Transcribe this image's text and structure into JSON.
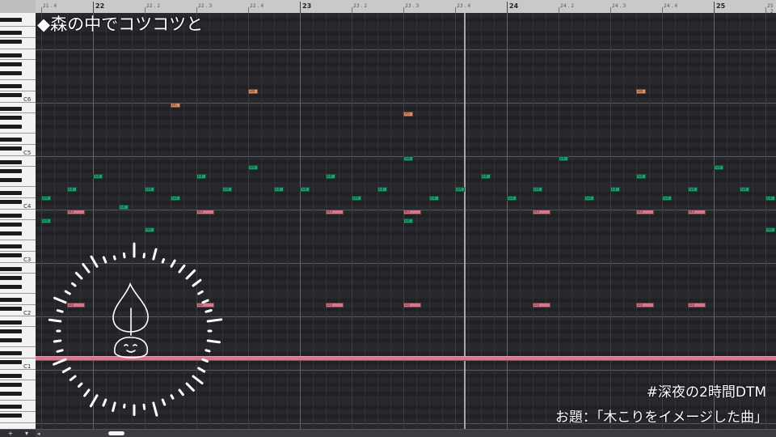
{
  "window": {
    "title": "◆森の中でコツコツと"
  },
  "ruler": {
    "bars": [
      "22",
      "23",
      "24",
      "25"
    ],
    "beats": [
      "21 . 4",
      "22 . 2",
      "22 . 3",
      "22 . 4",
      "23 . 2",
      "23 . 3",
      "23 . 4",
      "24 . 2",
      "24 . 3",
      "24 . 4",
      "25 . 2",
      "25 . 3"
    ]
  },
  "keyboard": {
    "octave_labels": [
      "C6",
      "C5",
      "C4",
      "C3",
      "C2",
      "C1"
    ]
  },
  "notes": {
    "green": [
      "D4",
      "E4",
      "G4",
      "E4",
      "D4",
      "G4",
      "E4",
      "D4",
      "D4",
      "E4",
      "G4",
      "E4",
      "D4",
      "E4",
      "G4",
      "E4",
      "D4",
      "E4",
      "G4",
      "D4",
      "E4",
      "G4",
      "E4",
      "G4",
      "G4",
      "G4",
      "G4",
      "G4",
      "E4",
      "G4",
      "A4",
      "E4",
      "A4"
    ],
    "pink": [
      "B3",
      "B3",
      "B3",
      "B3",
      "B3",
      "B3",
      "B3",
      "B3"
    ],
    "orange": [
      "D6",
      "B5",
      "A5",
      "D6"
    ]
  },
  "bass": {
    "labels": [
      "D1",
      "D1",
      "D1",
      "D1"
    ]
  },
  "overlay": {
    "hashtag": "#深夜の2時間DTM",
    "theme": "お題：「木こりをイメージした曲」"
  },
  "bottombar": {
    "add_label": "+",
    "menu_label": "▾",
    "scroll_left_label": "◂"
  },
  "colors": {
    "note_green": "#1e9f6d",
    "note_pink": "#d4798d",
    "note_orange": "#d9926a",
    "grid_bg": "#26282d"
  }
}
